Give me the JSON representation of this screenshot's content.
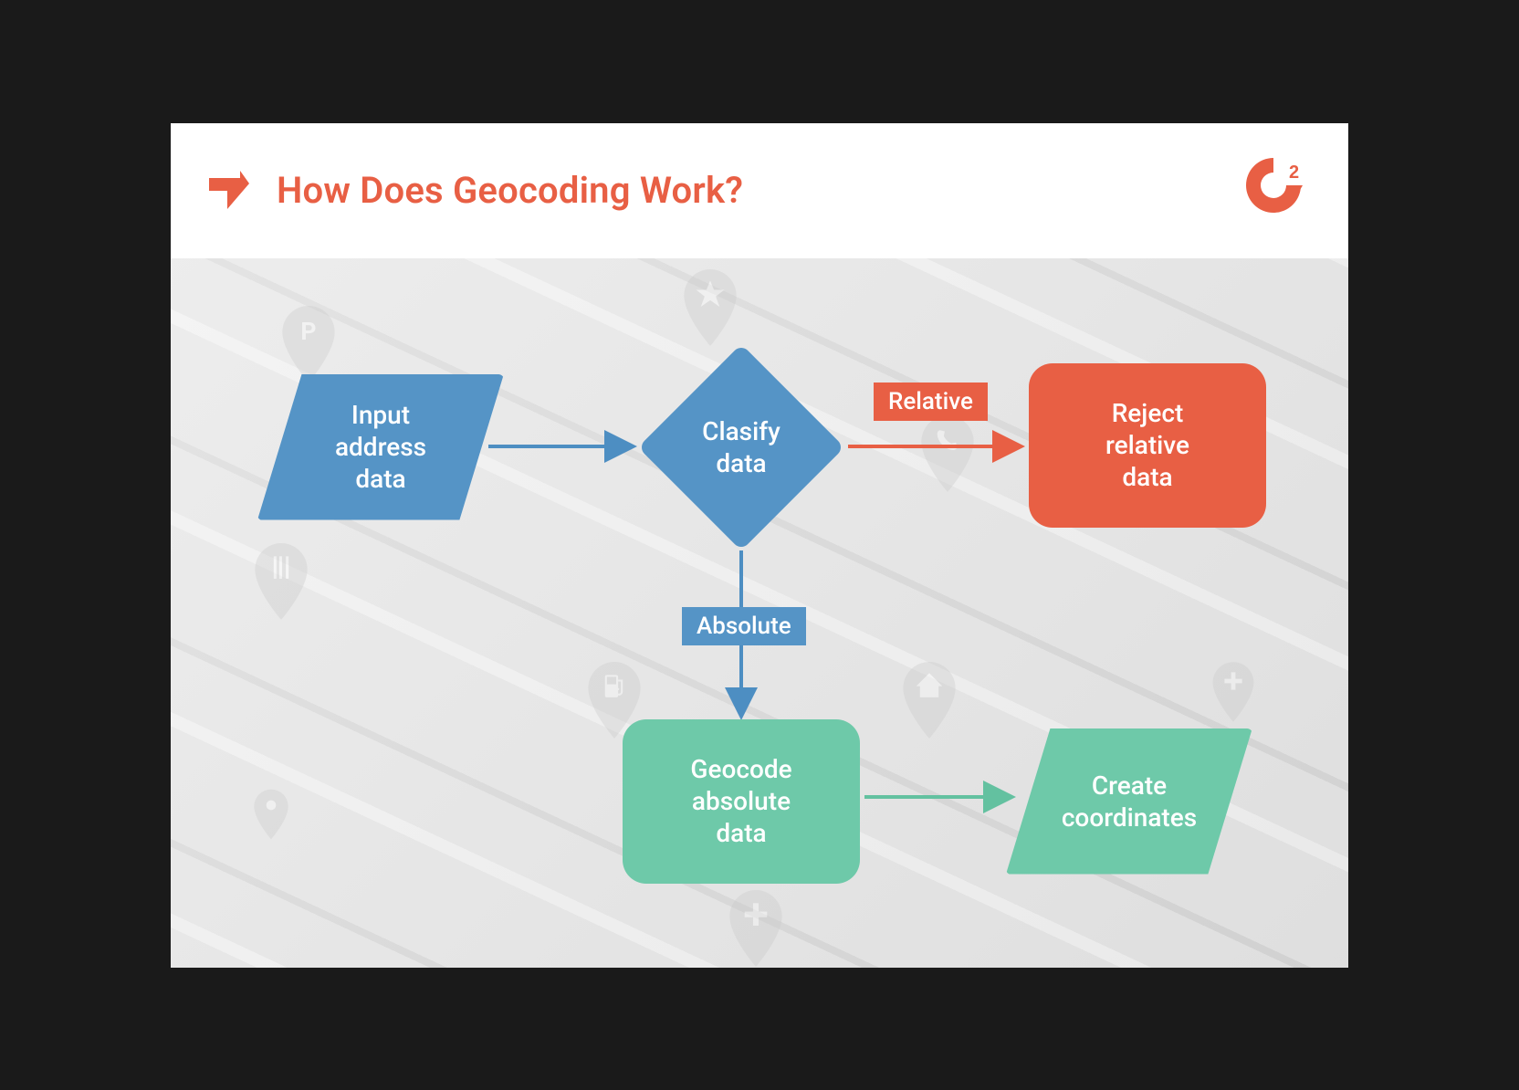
{
  "header": {
    "title": "How Does Geocoding Work?"
  },
  "nodes": {
    "input": {
      "label_line1": "Input",
      "label_line2": "address",
      "label_line3": "data"
    },
    "classify": {
      "label_line1": "Clasify",
      "label_line2": "data"
    },
    "reject": {
      "label_line1": "Reject",
      "label_line2": "relative",
      "label_line3": "data"
    },
    "geocode": {
      "label_line1": "Geocode",
      "label_line2": "absolute",
      "label_line3": "data"
    },
    "create": {
      "label_line1": "Create",
      "label_line2": "coordinates"
    }
  },
  "edges": {
    "relative_label": "Relative",
    "absolute_label": "Absolute"
  },
  "colors": {
    "orange": "#e85f44",
    "blue": "#5594c6",
    "green": "#6ec9a9"
  },
  "chart_data": {
    "type": "flowchart",
    "nodes": [
      {
        "id": "input",
        "shape": "parallelogram",
        "color": "blue",
        "text": "Input address data"
      },
      {
        "id": "classify",
        "shape": "diamond",
        "color": "blue",
        "text": "Clasify data"
      },
      {
        "id": "reject",
        "shape": "rounded-rect",
        "color": "orange",
        "text": "Reject relative data"
      },
      {
        "id": "geocode",
        "shape": "rounded-rect",
        "color": "green",
        "text": "Geocode absolute data"
      },
      {
        "id": "create",
        "shape": "parallelogram",
        "color": "green",
        "text": "Create coordinates"
      }
    ],
    "edges": [
      {
        "from": "input",
        "to": "classify",
        "label": "",
        "color": "blue"
      },
      {
        "from": "classify",
        "to": "reject",
        "label": "Relative",
        "color": "orange"
      },
      {
        "from": "classify",
        "to": "geocode",
        "label": "Absolute",
        "color": "blue"
      },
      {
        "from": "geocode",
        "to": "create",
        "label": "",
        "color": "green"
      }
    ],
    "title": "How Does Geocoding Work?"
  }
}
